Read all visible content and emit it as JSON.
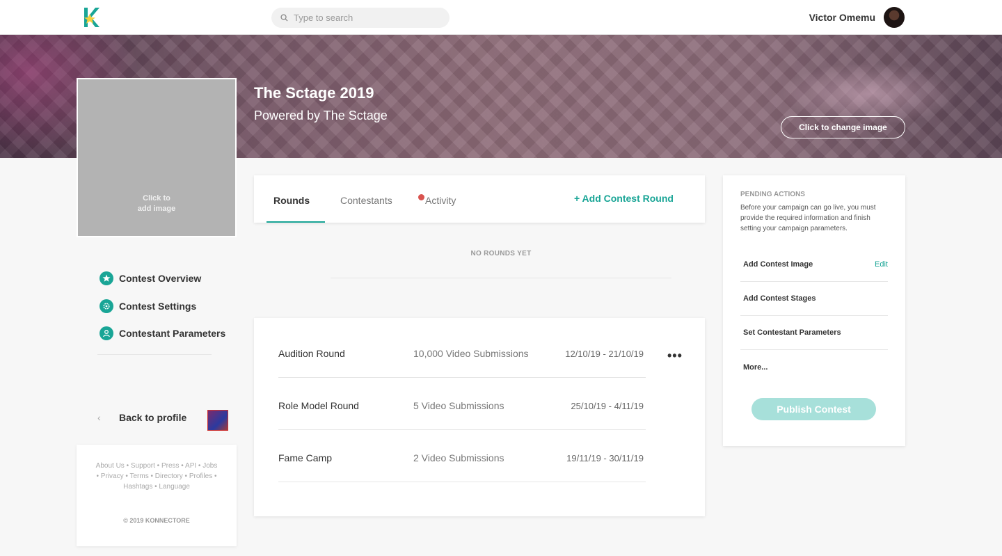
{
  "colors": {
    "accent": "#19a596",
    "publish_disabled": "#a7e0da",
    "alert_dot": "#d9534f"
  },
  "header": {
    "logo_icon": "konnectore-k-logo",
    "search_placeholder": "Type to search",
    "user_name": "Victor Omemu"
  },
  "banner": {
    "title": "The Sctage 2019",
    "subtitle": "Powered by The Sctage",
    "change_image_label": "Click to change image"
  },
  "image_placeholder": {
    "label": "Click to\nadd image"
  },
  "side_nav": {
    "items": [
      {
        "label": "Contest Overview",
        "icon": "star-icon"
      },
      {
        "label": "Contest Settings",
        "icon": "gear-icon"
      },
      {
        "label": "Contestant Parameters",
        "icon": "user-icon"
      }
    ]
  },
  "back_link": {
    "label": "Back to profile"
  },
  "footer": {
    "links": [
      "About Us",
      "Support",
      "Press",
      "API",
      "Jobs",
      "Privacy",
      "Terms",
      "Directory",
      "Profiles",
      "Hashtags",
      "Language"
    ],
    "copyright": "© 2019 KONNECTORE"
  },
  "tabs": {
    "items": [
      "Rounds",
      "Contestants",
      "Activity"
    ],
    "active": "Rounds",
    "add_round_label": "+ Add Contest Round"
  },
  "empty_state": "NO ROUNDS YET",
  "rounds": [
    {
      "name": "Audition Round",
      "submissions": "10,000 Video Submissions",
      "dates": "12/10/19 - 21/10/19"
    },
    {
      "name": "Role Model Round",
      "submissions": "5 Video Submissions",
      "dates": "25/10/19 - 4/11/19"
    },
    {
      "name": "Fame Camp",
      "submissions": "2 Video Submissions",
      "dates": "19/11/19 - 30/11/19"
    }
  ],
  "rounds_menu": "•••",
  "pending": {
    "title": "PENDING ACTIONS",
    "description": "Before your campaign can go live, you must provide the required information and finish setting your campaign parameters.",
    "items": [
      {
        "label": "Add Contest Image",
        "action": "Edit"
      },
      {
        "label": "Add Contest Stages"
      },
      {
        "label": "Set Contestant Parameters"
      },
      {
        "label": "More..."
      }
    ],
    "publish_label": "Publish Contest"
  }
}
